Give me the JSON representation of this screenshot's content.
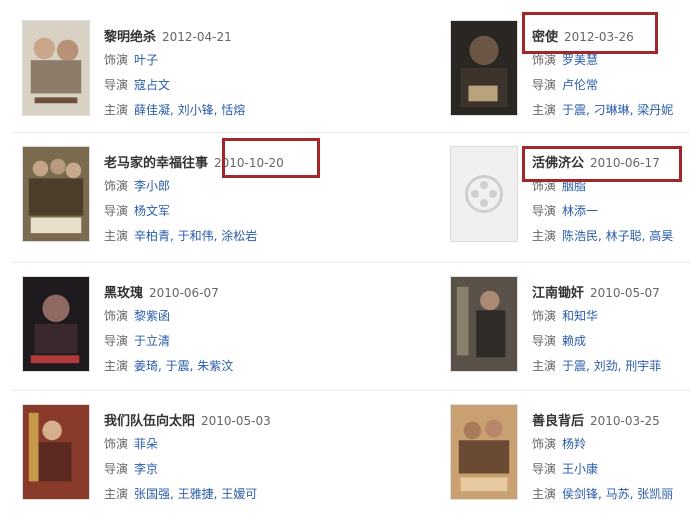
{
  "labels": {
    "actor": "饰演",
    "director": "导演",
    "cast": "主演"
  },
  "movies": [
    {
      "title": "黎明绝杀",
      "date": "2012-04-21",
      "actor": "叶子",
      "director": "寇占文",
      "cast": "薛佳凝, 刘小锋, 恬熔"
    },
    {
      "title": "密使",
      "date": "2012-03-26",
      "actor": "罗美慧",
      "director": "卢伦常",
      "cast": "于震, 刁琳琳, 梁丹妮"
    },
    {
      "title": "老马家的幸福往事",
      "date": "2010-10-20",
      "actor": "李小郎",
      "director": "杨文军",
      "cast": "辛柏青, 于和伟, 涂松岩"
    },
    {
      "title": "活佛济公",
      "date": "2010-06-17",
      "actor": "胭脂",
      "director": "林添一",
      "cast": "陈浩民, 林子聪, 高昊"
    },
    {
      "title": "黑玫瑰",
      "date": "2010-06-07",
      "actor": "黎紫函",
      "director": "于立清",
      "cast": "姜琦, 于震, 朱紫汶"
    },
    {
      "title": "江南锄奸",
      "date": "2010-05-07",
      "actor": "和知华",
      "director": "赖成",
      "cast": "于震, 刘劲, 刑宇菲"
    },
    {
      "title": "我们队伍向太阳",
      "date": "2010-05-03",
      "actor": "菲朵",
      "director": "李京",
      "cast": "张国强, 王雅捷, 王嫒可"
    },
    {
      "title": "善良背后",
      "date": "2010-03-25",
      "actor": "杨羚",
      "director": "王小康",
      "cast": "侯剑锋, 马苏, 张凯丽"
    }
  ],
  "colors": {
    "highlight": "#a3262a",
    "link": "#2a5caa"
  },
  "placeholder_icon": "film-reel-icon"
}
